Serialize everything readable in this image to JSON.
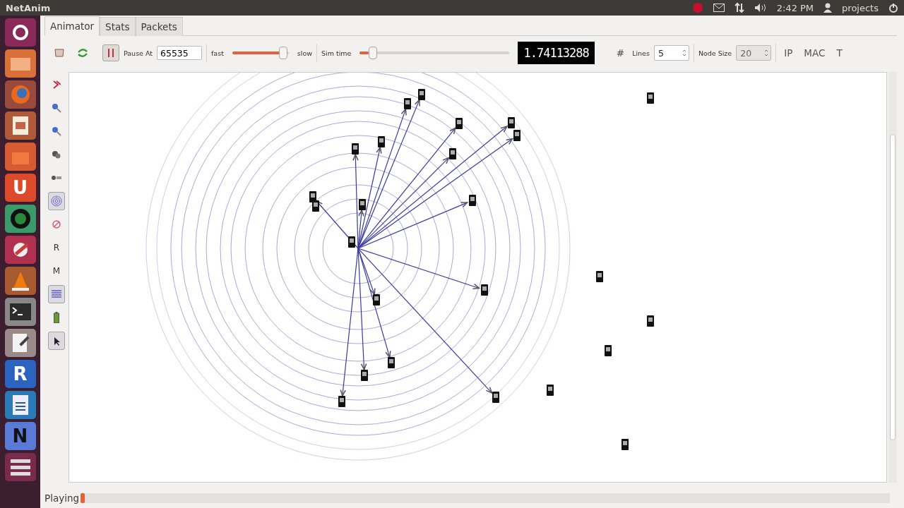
{
  "top_panel": {
    "title": "NetAnim",
    "time": "2:42 PM",
    "user": "projects"
  },
  "launcher": [
    {
      "kind": "dash"
    },
    {
      "kind": "files"
    },
    {
      "kind": "browser"
    },
    {
      "kind": "slides"
    },
    {
      "kind": "store"
    },
    {
      "kind": "letter",
      "label": "U"
    },
    {
      "kind": "globe"
    },
    {
      "kind": "tools"
    },
    {
      "kind": "cone"
    },
    {
      "kind": "terminal"
    },
    {
      "kind": "editor"
    },
    {
      "kind": "round",
      "label": "R"
    },
    {
      "kind": "document"
    },
    {
      "kind": "letter_blue",
      "label": "N"
    },
    {
      "kind": "stack"
    }
  ],
  "tabs": [
    {
      "label": "Animator",
      "selected": true
    },
    {
      "label": "Stats",
      "selected": false
    },
    {
      "label": "Packets",
      "selected": false
    }
  ],
  "toolbar": {
    "pause_label": "Pause At",
    "pause_value": "65535",
    "speed_fast": "fast",
    "speed_slow": "slow",
    "speed": {
      "level": 0.9
    },
    "sim_label": "Sim time",
    "sim": {
      "level": 0.02
    },
    "sim_display": "1.74113288",
    "grid_glyph": "#",
    "lines_label": "Lines",
    "lines_value": "5",
    "node_size_label": "Node Size",
    "node_size_value": "20",
    "node_size_disabled": true,
    "buttons": [
      "IP",
      "MAC",
      "T"
    ]
  },
  "left_tools": [
    {
      "kind": "chevron",
      "pressed": false
    },
    {
      "kind": "zoom_in",
      "pressed": false
    },
    {
      "kind": "zoom_out",
      "pressed": false
    },
    {
      "kind": "dots",
      "pressed": false
    },
    {
      "kind": "dots_small",
      "pressed": false
    },
    {
      "kind": "rings",
      "pressed": true
    },
    {
      "kind": "no",
      "pressed": false
    },
    {
      "kind": "text",
      "label": "R",
      "pressed": false
    },
    {
      "kind": "text",
      "label": "M",
      "pressed": false
    },
    {
      "kind": "lines",
      "pressed": true
    },
    {
      "kind": "battery",
      "pressed": false
    },
    {
      "kind": "pointer",
      "pressed": true
    }
  ],
  "status": {
    "text": "Playing",
    "progress": {
      "level": 0.005
    }
  }
}
